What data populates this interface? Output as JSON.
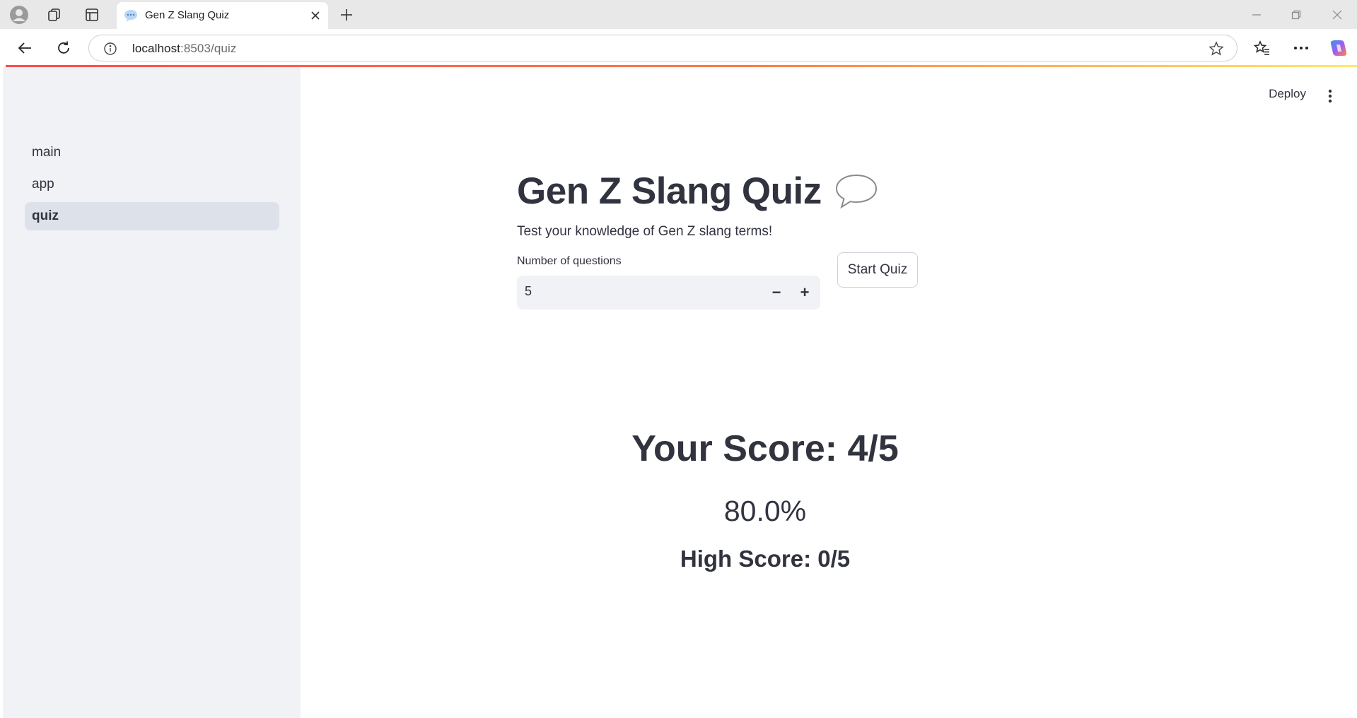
{
  "browser": {
    "tab_title": "Gen Z Slang Quiz",
    "url_host": "localhost",
    "url_rest": ":8503/quiz"
  },
  "sidebar": {
    "items": [
      {
        "label": "main",
        "active": false
      },
      {
        "label": "app",
        "active": false
      },
      {
        "label": "quiz",
        "active": true
      }
    ]
  },
  "header": {
    "deploy_label": "Deploy"
  },
  "main": {
    "title": "Gen Z Slang Quiz",
    "title_icon": "speech-balloon-icon",
    "subtitle": "Test your knowledge of Gen Z slang terms!",
    "questions_label": "Number of questions",
    "questions_value": "5",
    "decrement_label": "−",
    "increment_label": "+",
    "start_button": "Start Quiz"
  },
  "results": {
    "score_text": "Your Score: 4/5",
    "percent_text": "80.0%",
    "high_score_text": "High Score: 0/5"
  },
  "colors": {
    "sidebar_bg": "#f0f2f6",
    "text": "#31333f",
    "accent": "#ff4b4b"
  }
}
